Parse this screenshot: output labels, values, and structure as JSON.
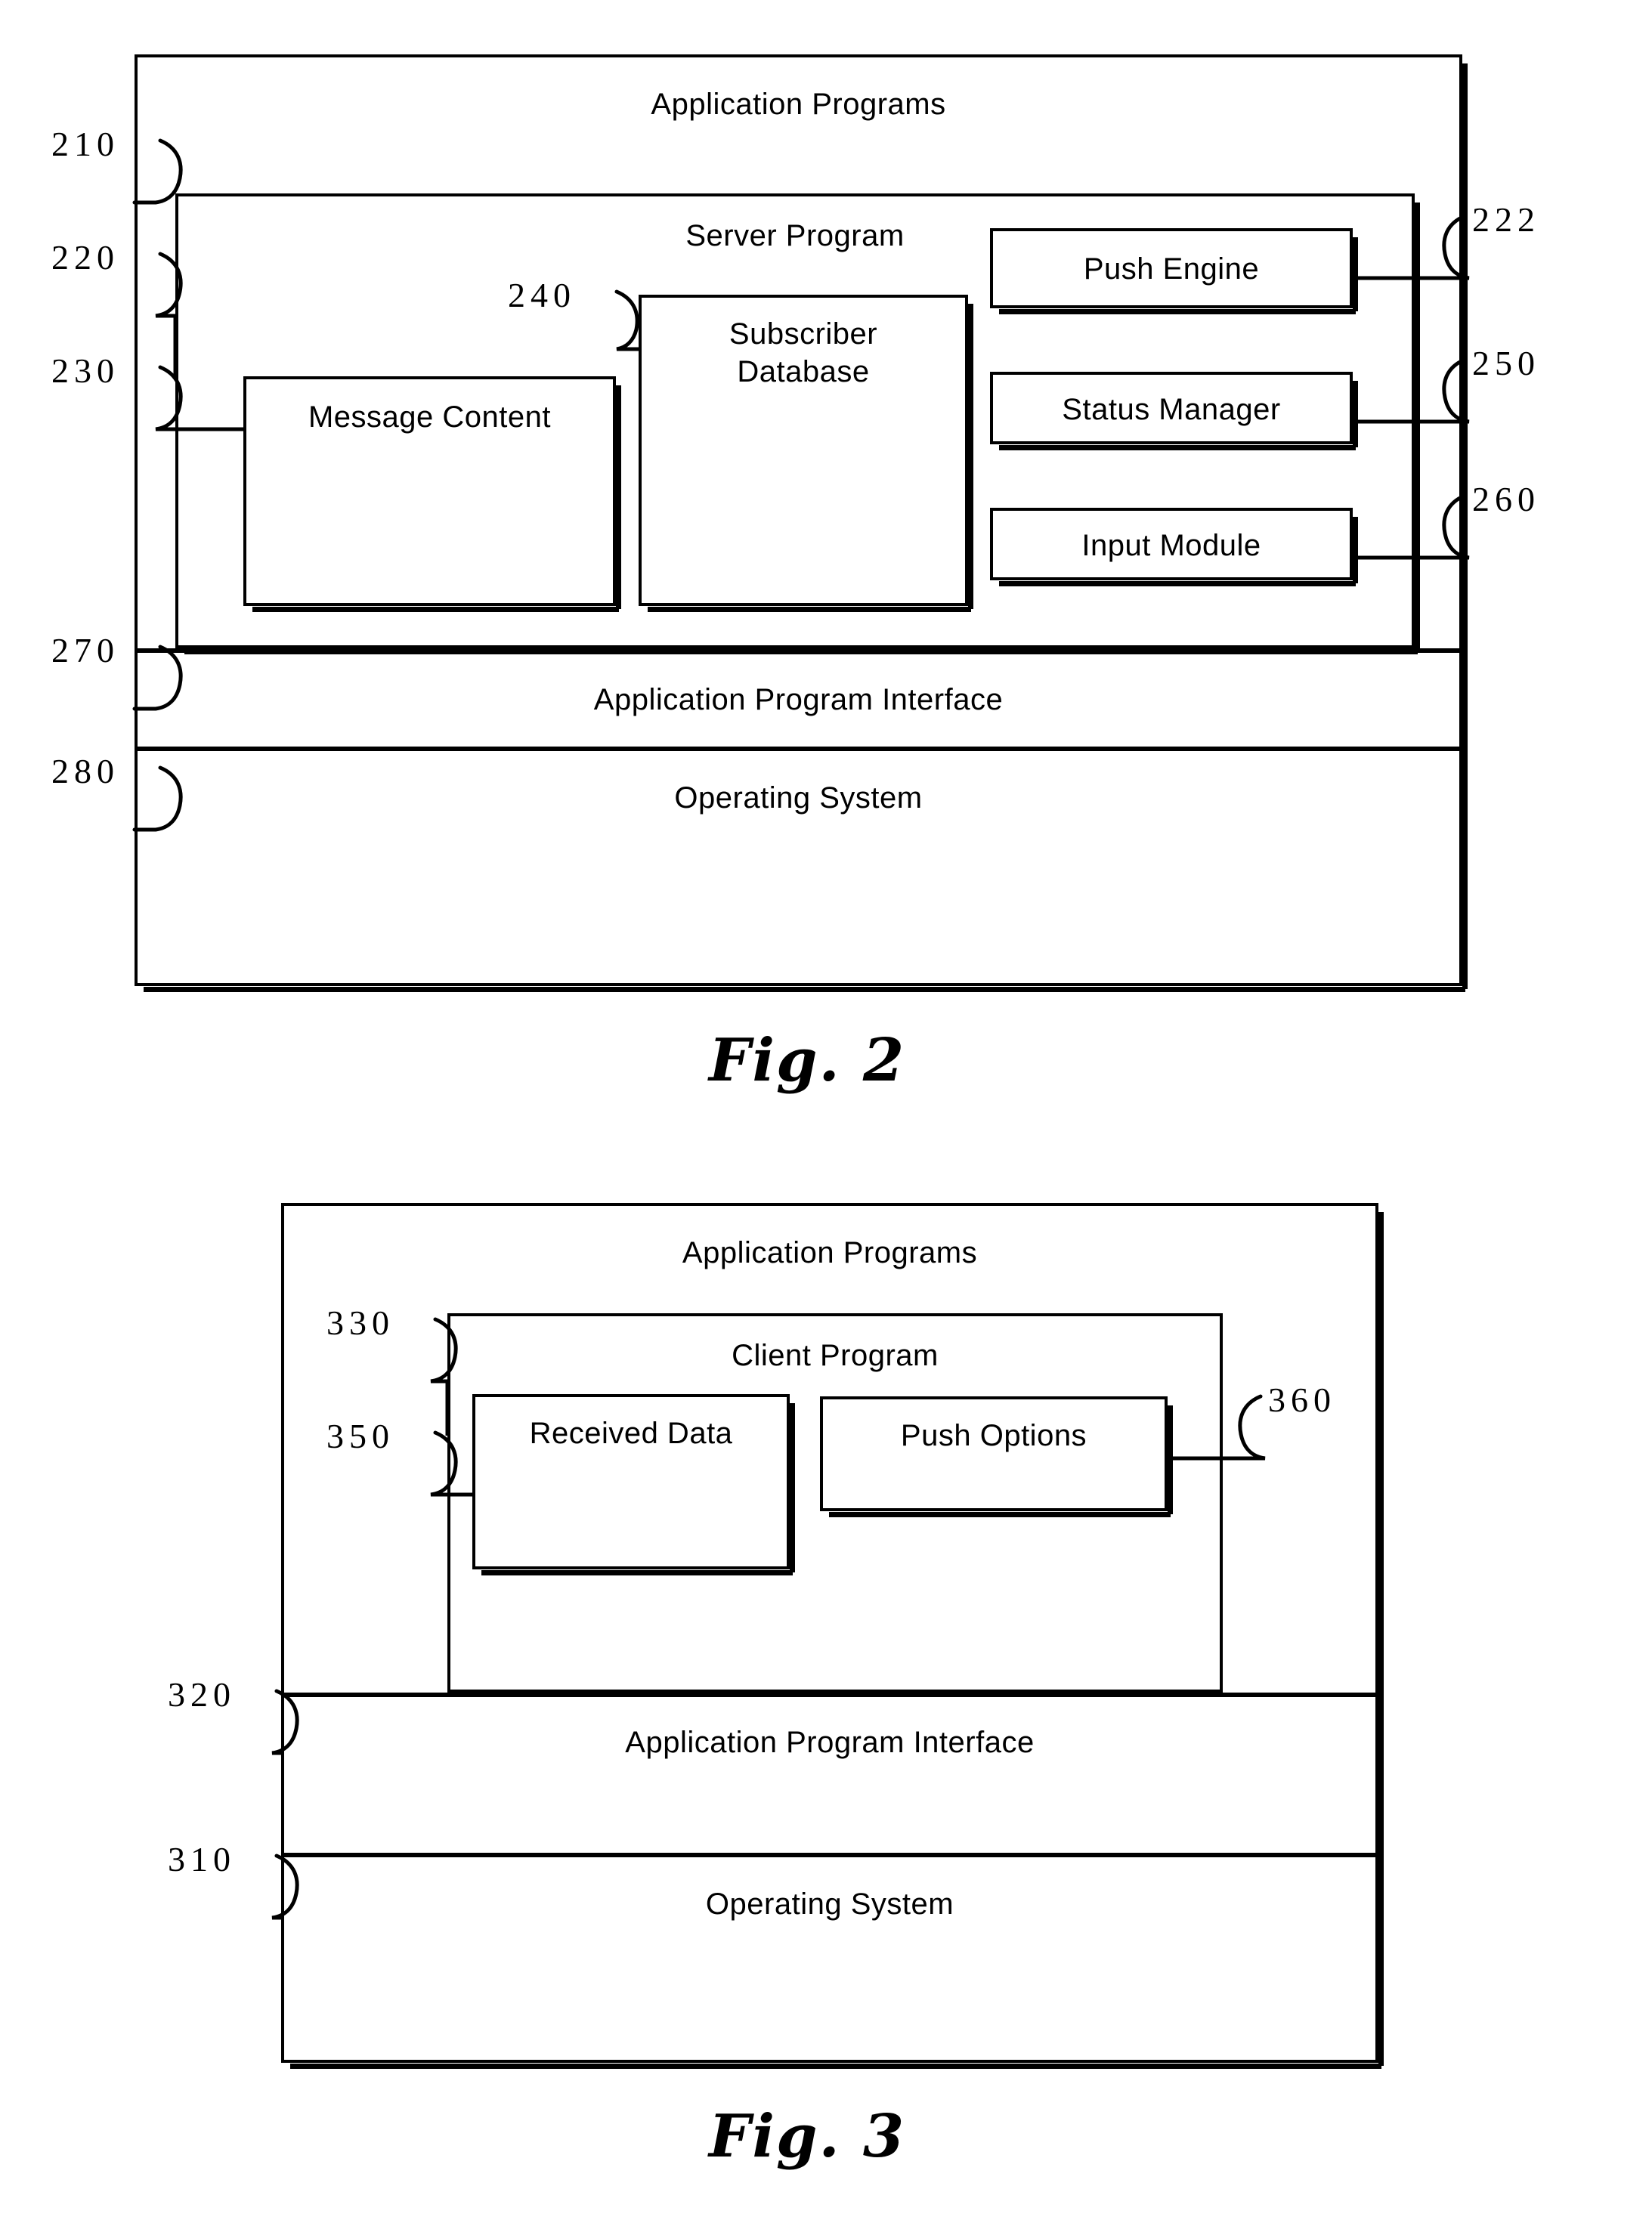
{
  "figures": [
    {
      "id": "fig2",
      "caption": "Fig.  2",
      "outer_label": "Application Programs",
      "outer_ref": "210",
      "server": {
        "label": "Server Program",
        "ref": "220",
        "boxes": [
          {
            "label": "Message Content",
            "ref": "230"
          },
          {
            "label": "Subscriber\nDatabase",
            "ref": "240",
            "line1": "Subscriber",
            "line2": "Database"
          },
          {
            "label": "Push Engine",
            "ref": "222"
          },
          {
            "label": "Status Manager",
            "ref": "250"
          },
          {
            "label": "Input Module",
            "ref": "260"
          }
        ]
      },
      "api": {
        "label": "Application Program Interface",
        "ref": "270"
      },
      "os": {
        "label": "Operating System",
        "ref": "280"
      }
    },
    {
      "id": "fig3",
      "caption": "Fig.  3",
      "outer_label": "Application Programs",
      "client": {
        "label": "Client Program",
        "ref": "330",
        "boxes": [
          {
            "label": "Received Data",
            "ref": "350"
          },
          {
            "label": "Push Options",
            "ref": "360"
          }
        ]
      },
      "api": {
        "label": "Application Program Interface",
        "ref": "320"
      },
      "os": {
        "label": "Operating System",
        "ref": "310"
      }
    }
  ],
  "colors": {
    "ink": "#000000",
    "paper": "#ffffff"
  }
}
